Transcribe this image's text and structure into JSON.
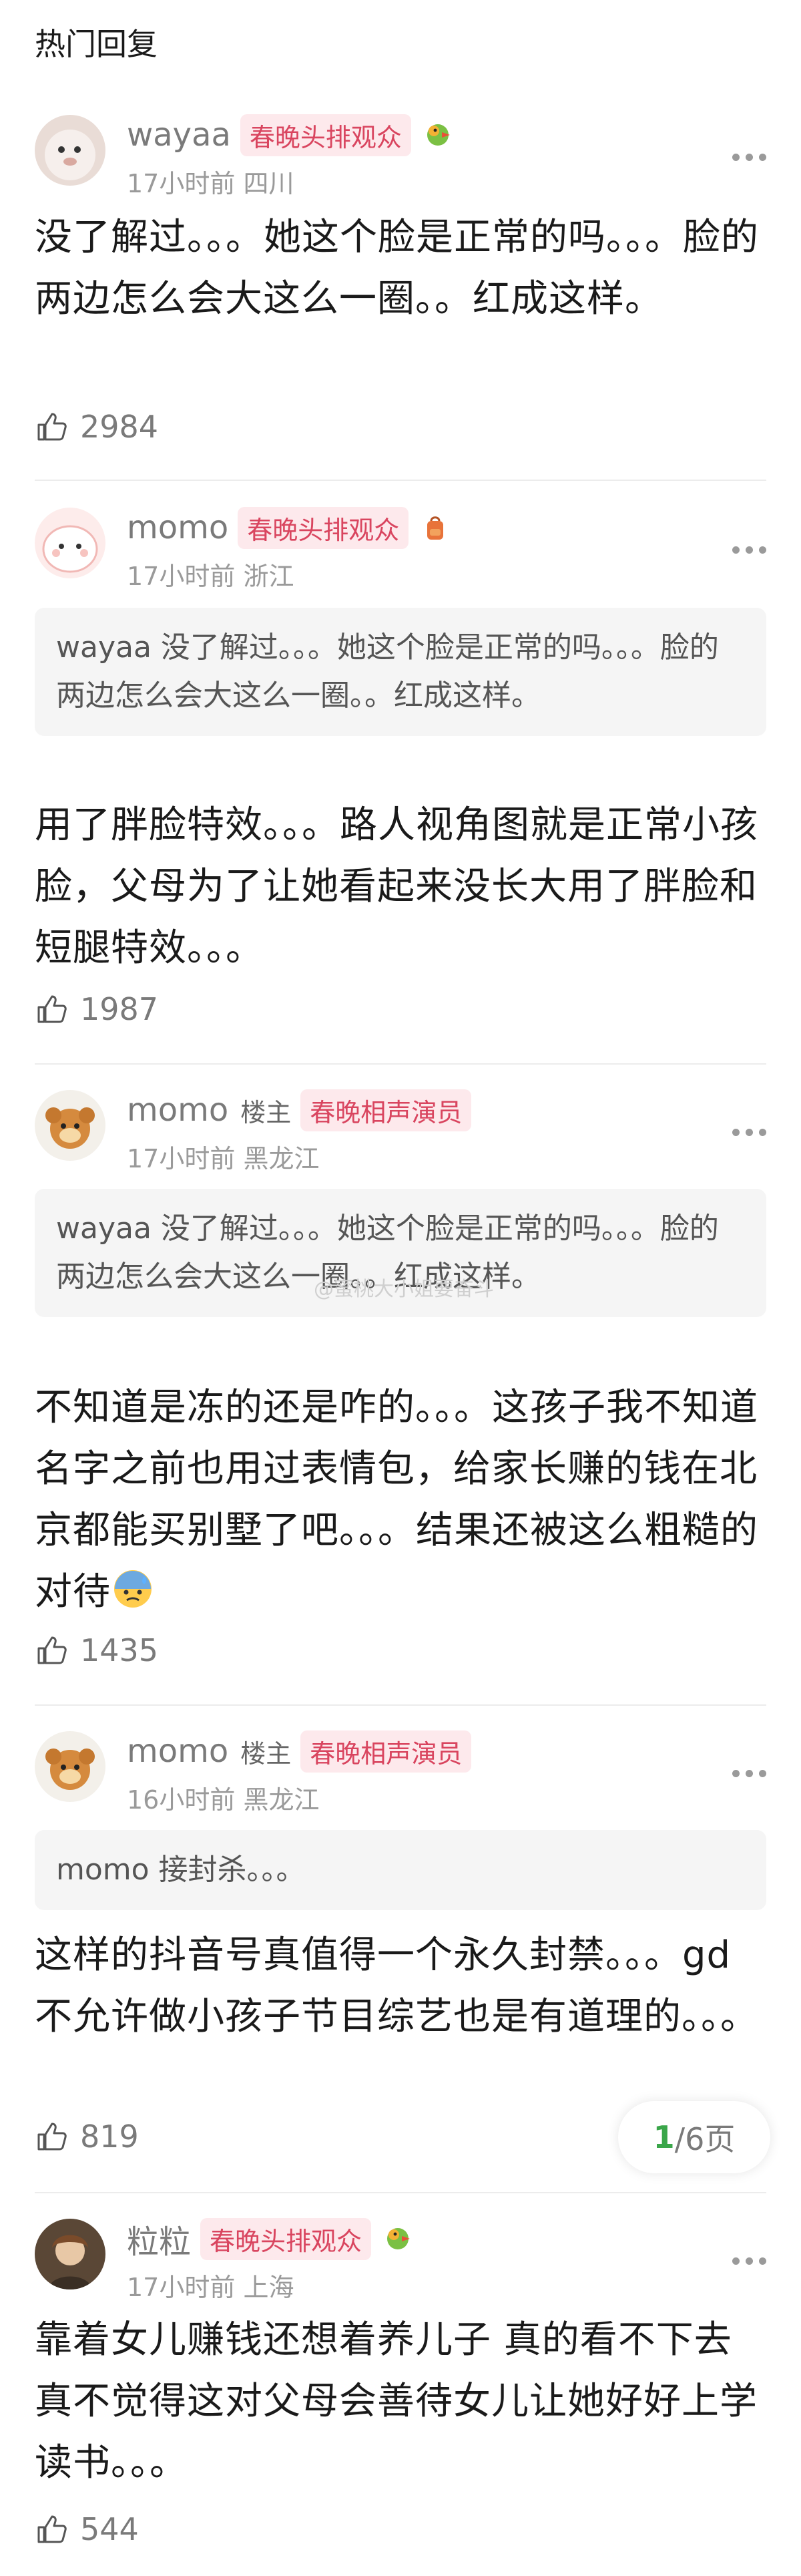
{
  "section_title": "热门回复",
  "colors": {
    "tag_text": "#d9455f",
    "tag_bg": "#fde9ec",
    "page_current": "#3aa64a"
  },
  "comments": [
    {
      "username": "wayaa",
      "is_op": false,
      "tag": "春晚头排观众",
      "badge_icon": "parrot-emoji-icon",
      "time": "17小时前",
      "location": "四川",
      "quote": null,
      "body": "没了解过。。。她这个脸是正常的吗。。。脸的两边怎么会大这么一圈。。红成这样。",
      "likes": "2984"
    },
    {
      "username": "momo",
      "is_op": false,
      "tag": "春晚头排观众",
      "badge_icon": "backpack-emoji-icon",
      "time": "17小时前",
      "location": "浙江",
      "quote": "wayaa 没了解过。。。她这个脸是正常的吗。。。脸的两边怎么会大这么一圈。。红成这样。",
      "body": "用了胖脸特效。。。路人视角图就是正常小孩脸，父母为了让她看起来没长大用了胖脸和短腿特效。。。",
      "likes": "1987"
    },
    {
      "username": "momo",
      "is_op": true,
      "op_label": "楼主",
      "tag": "春晚相声演员",
      "badge_icon": null,
      "time": "17小时前",
      "location": "黑龙江",
      "quote": "wayaa 没了解过。。。她这个脸是正常的吗。。。脸的两边怎么会大这么一圈。。红成这样。",
      "body": "不知道是冻的还是咋的。。。这孩子我不知道名字之前也用过表情包，给家长赚的钱在北京都能买别墅了吧。。。结果还被这么粗糙的对待",
      "body_emoji": "cold-sweat-emoji-icon",
      "likes": "1435"
    },
    {
      "username": "momo",
      "is_op": true,
      "op_label": "楼主",
      "tag": "春晚相声演员",
      "badge_icon": null,
      "time": "16小时前",
      "location": "黑龙江",
      "quote": "momo 接封杀。。。",
      "body": "这样的抖音号真值得一个永久封禁。。。gd不允许做小孩子节目综艺也是有道理的。。。",
      "likes": "819"
    },
    {
      "username": "粒粒",
      "is_op": false,
      "tag": "春晚头排观众",
      "badge_icon": "parrot-emoji-icon",
      "time": "17小时前",
      "location": "上海",
      "quote": null,
      "body": "靠着女儿赚钱还想着养儿子 真的看不下去 真不觉得这对父母会善待女儿让她好好上学读书。。。",
      "likes": "544"
    }
  ],
  "pager": {
    "current": "1",
    "total_label": "/6页"
  },
  "watermark": "@蜜桃大小姐要奋斗"
}
